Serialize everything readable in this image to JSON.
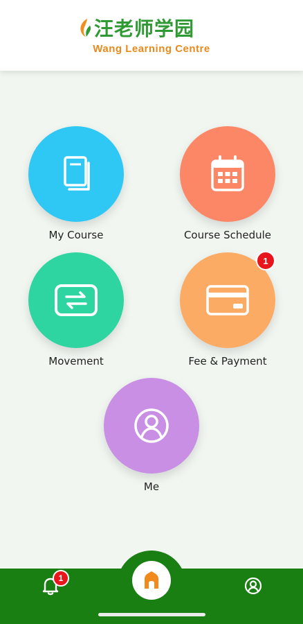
{
  "header": {
    "logo_cn": "汪老师学园",
    "logo_en": "Wang Learning Centre"
  },
  "tiles": [
    {
      "label": "My Course",
      "color": "#2fc8f4",
      "icon": "book-icon"
    },
    {
      "label": "Course Schedule",
      "color": "#fb8767",
      "icon": "calendar-icon"
    },
    {
      "label": "Movement",
      "color": "#2ed5a1",
      "icon": "transfer-icon"
    },
    {
      "label": "Fee & Payment",
      "color": "#fbab63",
      "icon": "credit-card-icon",
      "badge": "1"
    },
    {
      "label": "Me",
      "color": "#c88fe4",
      "icon": "user-icon"
    }
  ],
  "bottom_nav": {
    "notifications": {
      "icon": "bell-icon",
      "badge": "1"
    },
    "home": {
      "icon": "home-icon"
    },
    "profile": {
      "icon": "user-circle-icon"
    }
  },
  "colors": {
    "brand_green": "#2f9a33",
    "brand_orange": "#e88a1e",
    "nav_green": "#1a7f12",
    "badge_red": "#e8161c"
  }
}
